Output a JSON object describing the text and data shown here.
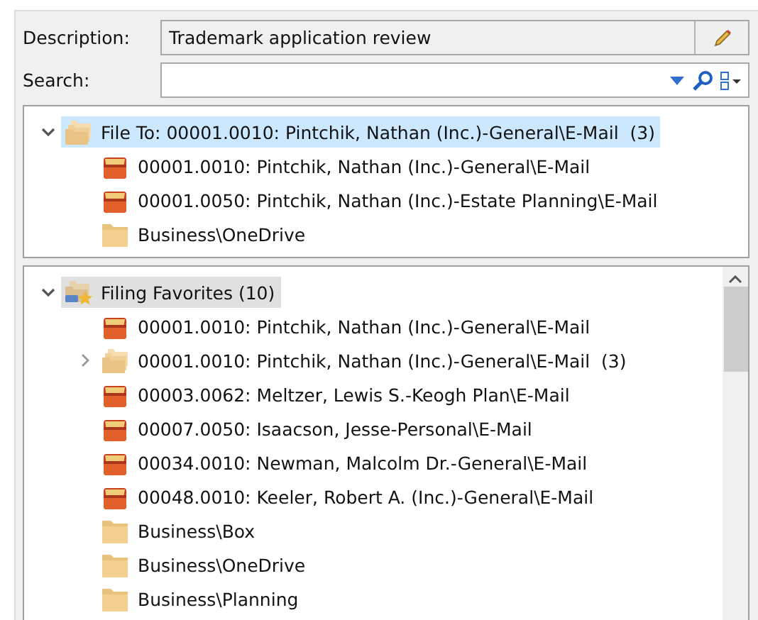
{
  "description": {
    "label": "Description:",
    "value": "Trademark application review"
  },
  "search": {
    "label": "Search:"
  },
  "trees": [
    {
      "focused": true,
      "scrollbar": false,
      "items": [
        {
          "kind": "folders",
          "label": "File To: 00001.0010: Pintchik, Nathan (Inc.)-General\\E-Mail  (3)",
          "selected": true,
          "expanded": true,
          "children": [
            {
              "kind": "matter",
              "label": "00001.0010: Pintchik, Nathan (Inc.)-General\\E-Mail",
              "selected": false
            },
            {
              "kind": "matter",
              "label": "00001.0050: Pintchik, Nathan (Inc.)-Estate Planning\\E-Mail",
              "selected": false
            },
            {
              "kind": "folder",
              "label": "Business\\OneDrive",
              "selected": false
            }
          ]
        }
      ]
    },
    {
      "focused": false,
      "scrollbar": true,
      "items": [
        {
          "kind": "favorites",
          "label": "Filing Favorites (10)",
          "selected": true,
          "expanded": true,
          "children": [
            {
              "kind": "matter",
              "label": "00001.0010: Pintchik, Nathan (Inc.)-General\\E-Mail",
              "selected": false
            },
            {
              "kind": "folders",
              "label": "00001.0010: Pintchik, Nathan (Inc.)-General\\E-Mail  (3)",
              "selected": false,
              "expanded": false
            },
            {
              "kind": "matter",
              "label": "00003.0062: Meltzer, Lewis S.-Keogh Plan\\E-Mail",
              "selected": false
            },
            {
              "kind": "matter",
              "label": "00007.0050: Isaacson, Jesse-Personal\\E-Mail",
              "selected": false
            },
            {
              "kind": "matter",
              "label": "00034.0010: Newman, Malcolm Dr.-General\\E-Mail",
              "selected": false
            },
            {
              "kind": "matter",
              "label": "00048.0010: Keeler, Robert A. (Inc.)-General\\E-Mail",
              "selected": false
            },
            {
              "kind": "folder",
              "label": "Business\\Box",
              "selected": false
            },
            {
              "kind": "folder",
              "label": "Business\\OneDrive",
              "selected": false
            },
            {
              "kind": "folder",
              "label": "Business\\Planning",
              "selected": false
            }
          ]
        }
      ]
    }
  ]
}
